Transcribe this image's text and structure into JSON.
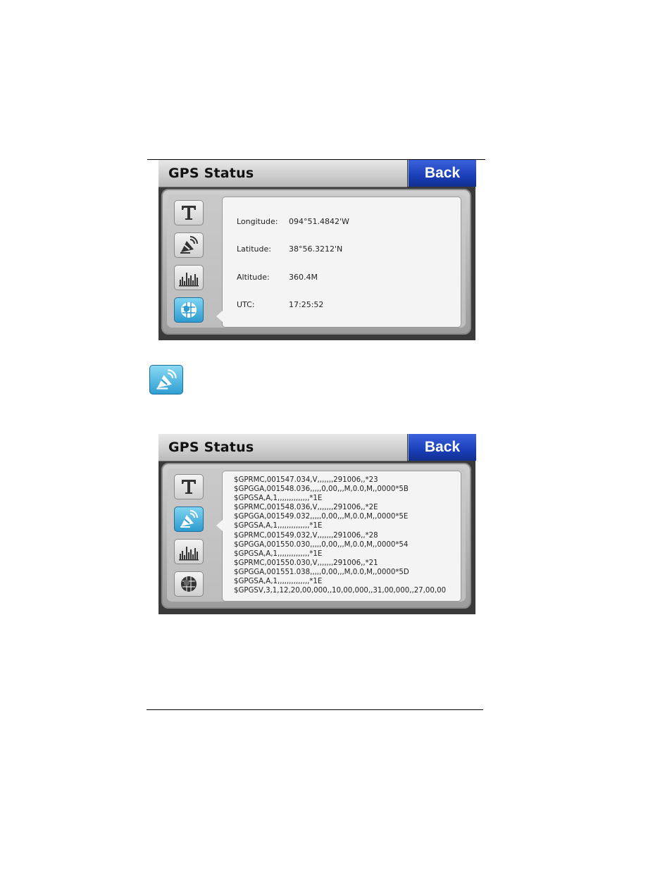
{
  "screen1": {
    "title": "GPS Status",
    "back_label": "Back",
    "rows": [
      {
        "label": "Longitude:",
        "value": "094°51.4842'W"
      },
      {
        "label": "Latitude:",
        "value": "38°56.3212'N"
      },
      {
        "label": "Altitude:",
        "value": "360.4M"
      },
      {
        "label": "UTC:",
        "value": "17:25:52"
      }
    ]
  },
  "screen2": {
    "title": "GPS Status",
    "back_label": "Back",
    "nmea_lines": [
      "$GPRMC,001547.034,V,,,,,,,291006,,*23",
      "$GPGGA,001548.036,,,,,0,00,,,M,0.0,M,,0000*5B",
      "$GPGSA,A,1,,,,,,,,,,,,,,*1E",
      "$GPRMC,001548.036,V,,,,,,,291006,,*2E",
      "$GPGGA,001549.032,,,,,0,00,,,M,0.0,M,,0000*5E",
      "$GPGSA,A,1,,,,,,,,,,,,,,*1E",
      "$GPRMC,001549.032,V,,,,,,,291006,,*28",
      "$GPGGA,001550.030,,,,,0,00,,,M,0.0,M,,0000*54",
      "$GPGSA,A,1,,,,,,,,,,,,,,*1E",
      "$GPRMC,001550.030,V,,,,,,,291006,,*21",
      "$GPGGA,001551.038,,,,,0,00,,,M,0.0,M,,0000*5D",
      "$GPGSA,A,1,,,,,,,,,,,,,,*1E",
      "$GPGSV,3,1,12,20,00,000,,10,00,000,,31,00,000,,27,00,00"
    ]
  },
  "icons": [
    "text-icon",
    "satellite-dish-icon",
    "signal-bars-icon",
    "globe-icon"
  ],
  "colors": {
    "accent": "#2d9bd0",
    "back_button": "#1a3fb8"
  }
}
